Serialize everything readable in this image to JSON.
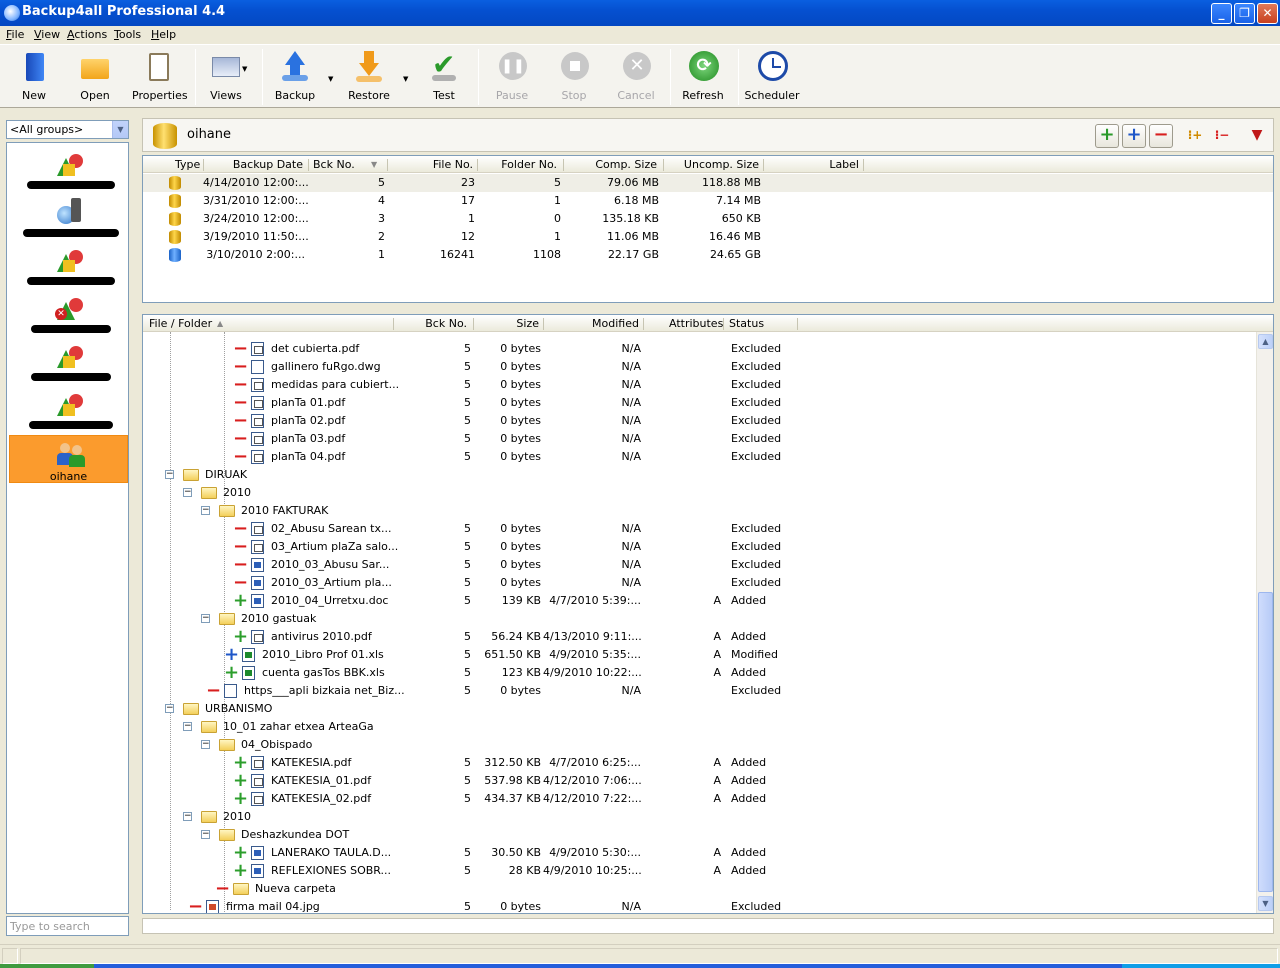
{
  "window": {
    "title": "Backup4all Professional 4.4"
  },
  "menu": [
    "File",
    "View",
    "Actions",
    "Tools",
    "Help"
  ],
  "toolbar": {
    "new": "New",
    "open": "Open",
    "properties": "Properties",
    "views": "Views",
    "backup": "Backup",
    "restore": "Restore",
    "test": "Test",
    "pause": "Pause",
    "stop": "Stop",
    "cancel": "Cancel",
    "refresh": "Refresh",
    "scheduler": "Scheduler"
  },
  "sidebar": {
    "group_selected": "<All groups>",
    "active_job": "oihane",
    "search_placeholder": "Type to search"
  },
  "job_header": {
    "name": "oihane"
  },
  "backups_table": {
    "columns": [
      "Type",
      "Backup Date",
      "Bck No.",
      "File No.",
      "Folder No.",
      "Comp. Size",
      "Uncomp. Size",
      "Label"
    ],
    "rows": [
      {
        "date": "4/14/2010 12:00:...",
        "bck": "5",
        "files": "23",
        "folders": "5",
        "comp": "79.06 MB",
        "uncomp": "118.88 MB",
        "type_icon": "incremental-db-icon"
      },
      {
        "date": "3/31/2010 12:00:...",
        "bck": "4",
        "files": "17",
        "folders": "1",
        "comp": "6.18 MB",
        "uncomp": "7.14 MB",
        "type_icon": "incremental-db-icon"
      },
      {
        "date": "3/24/2010 12:00:...",
        "bck": "3",
        "files": "1",
        "folders": "0",
        "comp": "135.18 KB",
        "uncomp": "650 KB",
        "type_icon": "incremental-db-icon"
      },
      {
        "date": "3/19/2010 11:50:...",
        "bck": "2",
        "files": "12",
        "folders": "1",
        "comp": "11.06 MB",
        "uncomp": "16.46 MB",
        "type_icon": "incremental-db-icon"
      },
      {
        "date": "3/10/2010 2:00:...",
        "bck": "1",
        "files": "16241",
        "folders": "1108",
        "comp": "22.17 GB",
        "uncomp": "24.65 GB",
        "type_icon": "full-db-icon"
      }
    ]
  },
  "files_table": {
    "columns": [
      "File / Folder",
      "Bck No.",
      "Size",
      "Modified",
      "Attributes",
      "Status"
    ],
    "rows": [
      {
        "level": 4,
        "kind": "file",
        "ftype": "pdf",
        "mark": "minus",
        "name": "det cubierta.pdf",
        "bck": "5",
        "size": "0 bytes",
        "modified": "N/A",
        "attr": "",
        "status": "Excluded"
      },
      {
        "level": 4,
        "kind": "file",
        "ftype": "dwg",
        "mark": "minus",
        "name": "gallinero fuRgo.dwg",
        "bck": "5",
        "size": "0 bytes",
        "modified": "N/A",
        "attr": "",
        "status": "Excluded"
      },
      {
        "level": 4,
        "kind": "file",
        "ftype": "pdf",
        "mark": "minus",
        "name": "medidas para cubiert...",
        "bck": "5",
        "size": "0 bytes",
        "modified": "N/A",
        "attr": "",
        "status": "Excluded"
      },
      {
        "level": 4,
        "kind": "file",
        "ftype": "pdf",
        "mark": "minus",
        "name": "planTa 01.pdf",
        "bck": "5",
        "size": "0 bytes",
        "modified": "N/A",
        "attr": "",
        "status": "Excluded"
      },
      {
        "level": 4,
        "kind": "file",
        "ftype": "pdf",
        "mark": "minus",
        "name": "planTa 02.pdf",
        "bck": "5",
        "size": "0 bytes",
        "modified": "N/A",
        "attr": "",
        "status": "Excluded"
      },
      {
        "level": 4,
        "kind": "file",
        "ftype": "pdf",
        "mark": "minus",
        "name": "planTa 03.pdf",
        "bck": "5",
        "size": "0 bytes",
        "modified": "N/A",
        "attr": "",
        "status": "Excluded"
      },
      {
        "level": 4,
        "kind": "file",
        "ftype": "pdf",
        "mark": "minus",
        "name": "planTa 04.pdf",
        "bck": "5",
        "size": "0 bytes",
        "modified": "N/A",
        "attr": "",
        "status": "Excluded"
      },
      {
        "level": 1,
        "kind": "folder",
        "name": "DIRUAK",
        "bck": "",
        "size": "",
        "modified": "",
        "attr": "",
        "status": ""
      },
      {
        "level": 2,
        "kind": "folder",
        "name": "2010",
        "bck": "",
        "size": "",
        "modified": "",
        "attr": "",
        "status": ""
      },
      {
        "level": 3,
        "kind": "folder",
        "name": "2010 FAKTURAK",
        "bck": "",
        "size": "",
        "modified": "",
        "attr": "",
        "status": ""
      },
      {
        "level": 4,
        "kind": "file",
        "ftype": "pdf",
        "mark": "minus",
        "name": "02_Abusu Sarean tx...",
        "bck": "5",
        "size": "0 bytes",
        "modified": "N/A",
        "attr": "",
        "status": "Excluded"
      },
      {
        "level": 4,
        "kind": "file",
        "ftype": "pdf",
        "mark": "minus",
        "name": "03_Artium plaZa salo...",
        "bck": "5",
        "size": "0 bytes",
        "modified": "N/A",
        "attr": "",
        "status": "Excluded"
      },
      {
        "level": 4,
        "kind": "file",
        "ftype": "doc",
        "mark": "minus",
        "name": "2010_03_Abusu Sar...",
        "bck": "5",
        "size": "0 bytes",
        "modified": "N/A",
        "attr": "",
        "status": "Excluded"
      },
      {
        "level": 4,
        "kind": "file",
        "ftype": "doc",
        "mark": "minus",
        "name": "2010_03_Artium pla...",
        "bck": "5",
        "size": "0 bytes",
        "modified": "N/A",
        "attr": "",
        "status": "Excluded"
      },
      {
        "level": 4,
        "kind": "file",
        "ftype": "doc",
        "mark": "plus",
        "name": "2010_04_Urretxu.doc",
        "bck": "5",
        "size": "139 KB",
        "modified": "4/7/2010 5:39:...",
        "attr": "A",
        "status": "Added"
      },
      {
        "level": 3,
        "kind": "folder",
        "name": "2010 gastuak",
        "bck": "",
        "size": "",
        "modified": "",
        "attr": "",
        "status": ""
      },
      {
        "level": 4,
        "kind": "file",
        "ftype": "pdf",
        "mark": "plus",
        "name": "antivirus 2010.pdf",
        "bck": "5",
        "size": "56.24 KB",
        "modified": "4/13/2010 9:11:...",
        "attr": "A",
        "status": "Added"
      },
      {
        "level": 3.5,
        "kind": "file",
        "ftype": "xls",
        "mark": "plusb",
        "name": "2010_Libro Prof 01.xls",
        "bck": "5",
        "size": "651.50 KB",
        "modified": "4/9/2010 5:35:...",
        "attr": "A",
        "status": "Modified"
      },
      {
        "level": 3.5,
        "kind": "file",
        "ftype": "xls",
        "mark": "plus",
        "name": "cuenta gasTos BBK.xls",
        "bck": "5",
        "size": "123 KB",
        "modified": "4/9/2010 10:22:...",
        "attr": "A",
        "status": "Added"
      },
      {
        "level": 2.5,
        "kind": "file",
        "ftype": "htm",
        "mark": "minus",
        "name": "https___apli bizkaia net_Biz...",
        "bck": "5",
        "size": "0 bytes",
        "modified": "N/A",
        "attr": "",
        "status": "Excluded"
      },
      {
        "level": 1,
        "kind": "folder",
        "name": "URBANISMO",
        "bck": "",
        "size": "",
        "modified": "",
        "attr": "",
        "status": ""
      },
      {
        "level": 2,
        "kind": "folder",
        "name": "10_01 zahar etxea ArteaGa",
        "bck": "",
        "size": "",
        "modified": "",
        "attr": "",
        "status": ""
      },
      {
        "level": 3,
        "kind": "folder",
        "name": "04_Obispado",
        "bck": "",
        "size": "",
        "modified": "",
        "attr": "",
        "status": ""
      },
      {
        "level": 4,
        "kind": "file",
        "ftype": "pdf",
        "mark": "plus",
        "name": "KATEKESIA.pdf",
        "bck": "5",
        "size": "312.50 KB",
        "modified": "4/7/2010 6:25:...",
        "attr": "A",
        "status": "Added"
      },
      {
        "level": 4,
        "kind": "file",
        "ftype": "pdf",
        "mark": "plus",
        "name": "KATEKESIA_01.pdf",
        "bck": "5",
        "size": "537.98 KB",
        "modified": "4/12/2010 7:06:...",
        "attr": "A",
        "status": "Added"
      },
      {
        "level": 4,
        "kind": "file",
        "ftype": "pdf",
        "mark": "plus",
        "name": "KATEKESIA_02.pdf",
        "bck": "5",
        "size": "434.37 KB",
        "modified": "4/12/2010 7:22:...",
        "attr": "A",
        "status": "Added"
      },
      {
        "level": 2,
        "kind": "folder",
        "name": "2010",
        "bck": "",
        "size": "",
        "modified": "",
        "attr": "",
        "status": ""
      },
      {
        "level": 3,
        "kind": "folder",
        "name": "Deshazkundea  DOT",
        "bck": "",
        "size": "",
        "modified": "",
        "attr": "",
        "status": ""
      },
      {
        "level": 4,
        "kind": "file",
        "ftype": "doc",
        "mark": "plus",
        "name": "LANERAKO TAULA.D...",
        "bck": "5",
        "size": "30.50 KB",
        "modified": "4/9/2010 5:30:...",
        "attr": "A",
        "status": "Added"
      },
      {
        "level": 4,
        "kind": "file",
        "ftype": "doc",
        "mark": "plus",
        "name": "REFLEXIONES SOBR...",
        "bck": "5",
        "size": "28 KB",
        "modified": "4/9/2010 10:25:...",
        "attr": "A",
        "status": "Added"
      },
      {
        "level": 3,
        "kind": "folder-minus",
        "name": "Nueva carpeta",
        "bck": "",
        "size": "",
        "modified": "",
        "attr": "",
        "status": ""
      },
      {
        "level": 1.5,
        "kind": "file",
        "ftype": "jpg",
        "mark": "minus",
        "name": "firma mail 04.jpg",
        "bck": "5",
        "size": "0 bytes",
        "modified": "N/A",
        "attr": "",
        "status": "Excluded"
      }
    ]
  }
}
